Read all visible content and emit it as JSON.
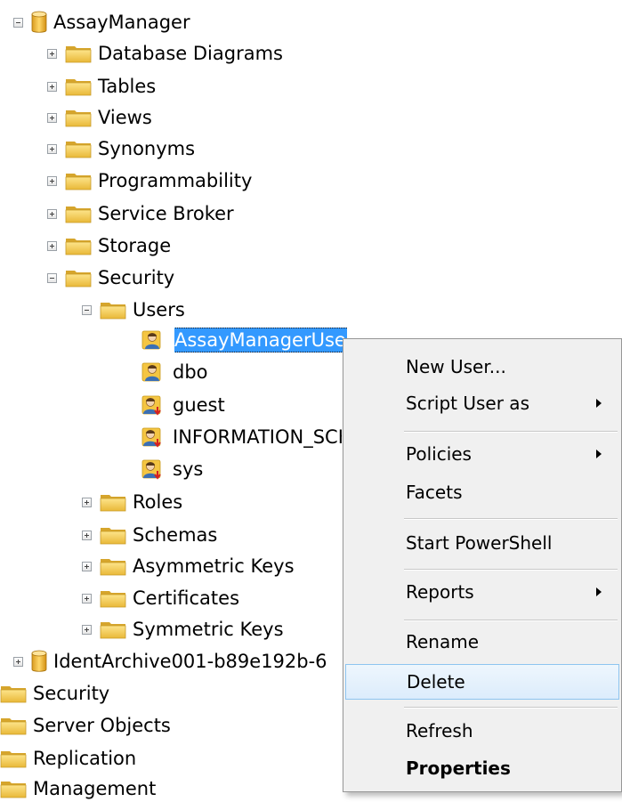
{
  "tree": {
    "database": "AssayManager",
    "db_children": [
      "Database Diagrams",
      "Tables",
      "Views",
      "Synonyms",
      "Programmability",
      "Service Broker",
      "Storage"
    ],
    "security": "Security",
    "users_folder": "Users",
    "users": [
      "AssayManagerUser",
      "dbo",
      "guest",
      "INFORMATION_SCHEMA",
      "sys"
    ],
    "security_children": [
      "Roles",
      "Schemas",
      "Asymmetric Keys",
      "Certificates",
      "Symmetric Keys"
    ],
    "other_database": "IdentArchive001-b89e192b-6",
    "server_folders": [
      "Security",
      "Server Objects",
      "Replication",
      "Management"
    ]
  },
  "context_menu": {
    "items": [
      {
        "label": "New User...",
        "submenu": false
      },
      {
        "label": "Script User as",
        "submenu": true
      },
      {
        "label": "Policies",
        "submenu": true
      },
      {
        "label": "Facets",
        "submenu": false
      },
      {
        "label": "Start PowerShell",
        "submenu": false
      },
      {
        "label": "Reports",
        "submenu": true
      },
      {
        "label": "Rename",
        "submenu": false
      },
      {
        "label": "Delete",
        "submenu": false,
        "highlighted": true
      },
      {
        "label": "Refresh",
        "submenu": false
      },
      {
        "label": "Properties",
        "submenu": false,
        "bold": true
      }
    ]
  },
  "colors": {
    "selection": "#3399ff",
    "menu_background": "#f0f0f0",
    "menu_hover": "#dcecfc",
    "folder": "#f2c94c"
  }
}
